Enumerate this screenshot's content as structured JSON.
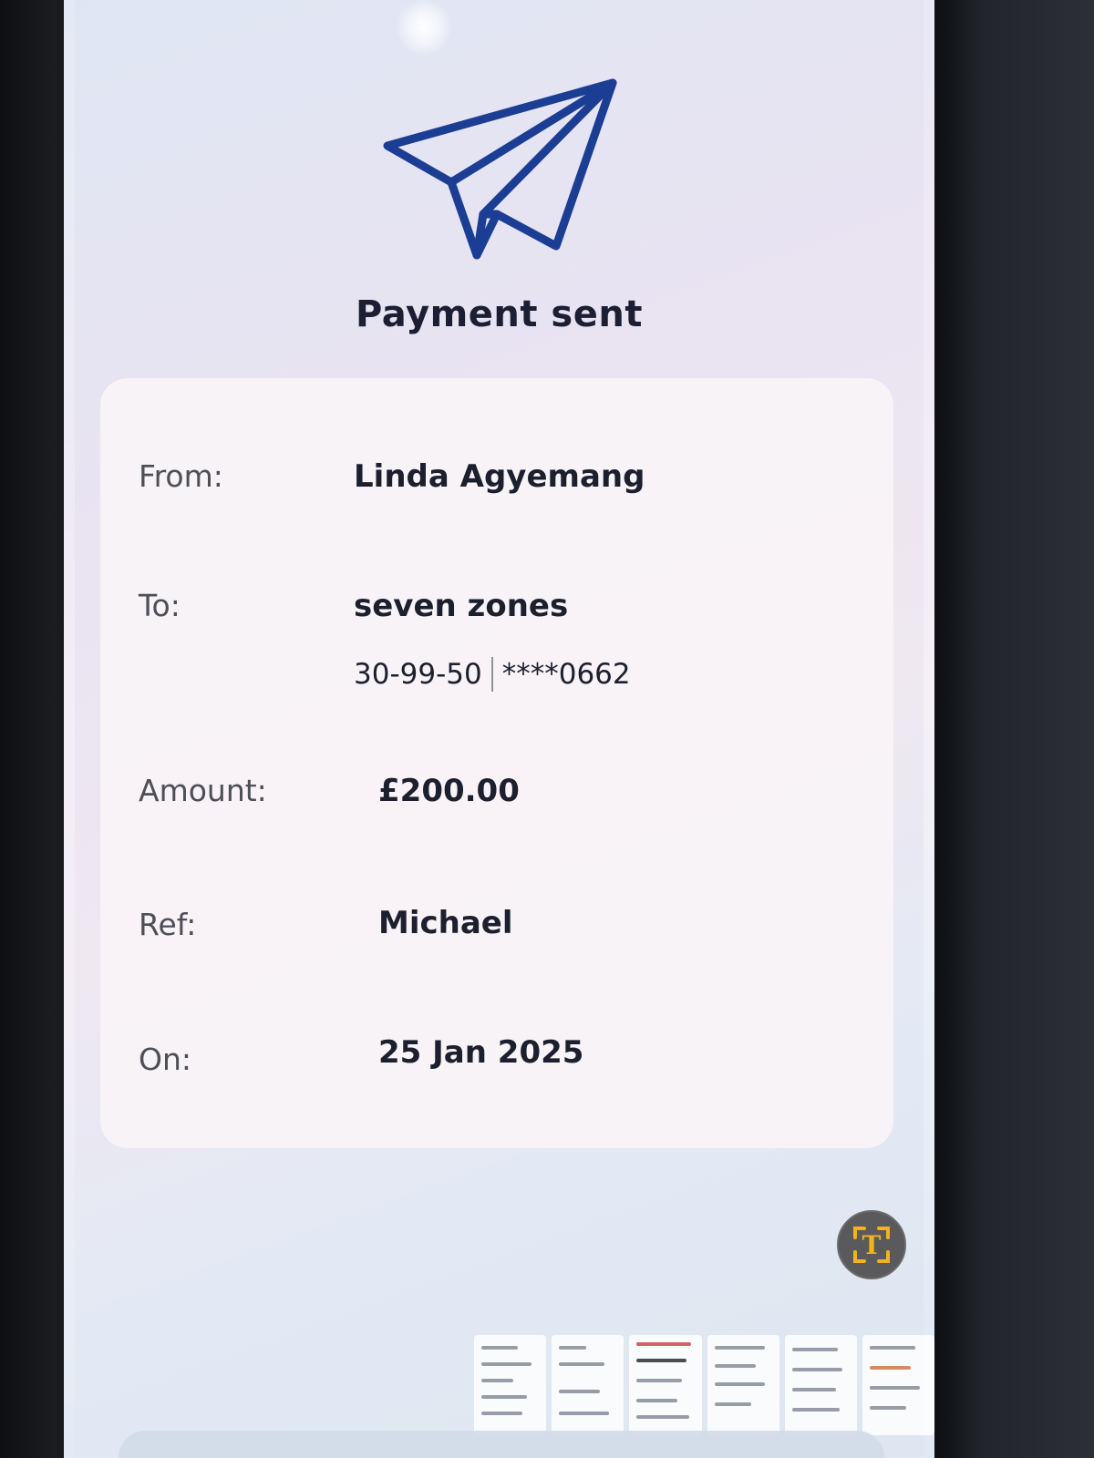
{
  "header": {
    "icon": "paper-plane-icon",
    "title": "Payment sent"
  },
  "details": {
    "from": {
      "label": "From:",
      "value": "Linda Agyemang"
    },
    "to": {
      "label": "To:",
      "value": "seven zones",
      "sort_code": "30-99-50",
      "account_masked": "****0662"
    },
    "amount": {
      "label": "Amount:",
      "value": "£200.00"
    },
    "ref": {
      "label": "Ref:",
      "value": "Michael"
    },
    "on": {
      "label": "On:",
      "value": "25 Jan 2025"
    }
  },
  "overlay": {
    "scan_text_icon": "scan-text-icon",
    "scan_text_glyph": "T"
  },
  "colors": {
    "accent": "#1b3d93",
    "title_text": "#1c1f33",
    "label_text": "#4d4f58",
    "card_bg": "#faf4f7",
    "scan_button_bg": "#5a5a5c",
    "scan_button_accent": "#f2b41c"
  }
}
